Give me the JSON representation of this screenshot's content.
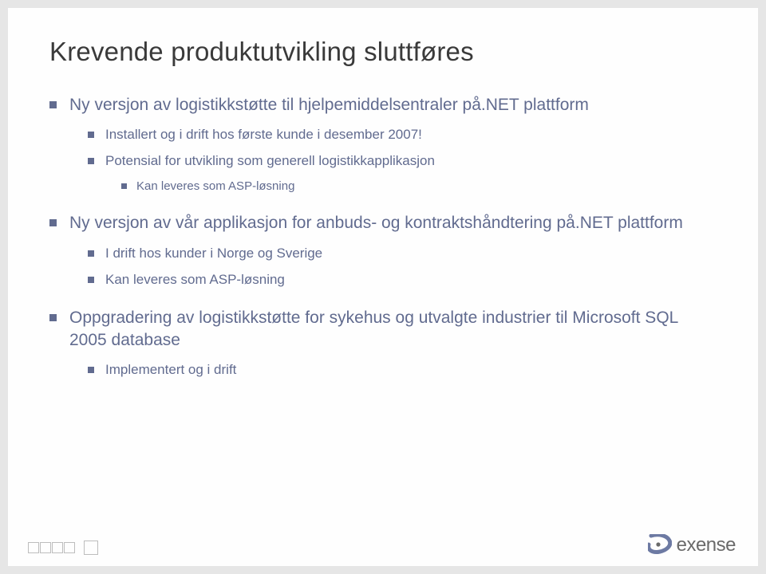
{
  "title": "Krevende produktutvikling sluttføres",
  "bullets": [
    {
      "text": "Ny versjon av logistikkstøtte til hjelpemiddelsentraler på.NET plattform",
      "children": [
        {
          "text": "Installert og i drift hos første kunde i desember 2007!"
        },
        {
          "text": "Potensial for utvikling som generell logistikkapplikasjon",
          "children": [
            {
              "text": "Kan leveres som ASP-løsning"
            }
          ]
        }
      ]
    },
    {
      "text": "Ny versjon av vår applikasjon for anbuds- og kontraktshåndtering på.NET plattform",
      "children": [
        {
          "text": "I drift hos kunder i Norge og Sverige"
        },
        {
          "text": "Kan leveres som ASP-løsning"
        }
      ]
    },
    {
      "text": "Oppgradering av logistikkstøtte for sykehus og utvalgte industrier til Microsoft SQL 2005 database",
      "children": [
        {
          "text": "Implementert og i drift"
        }
      ]
    }
  ],
  "logo": {
    "text": "exense"
  }
}
